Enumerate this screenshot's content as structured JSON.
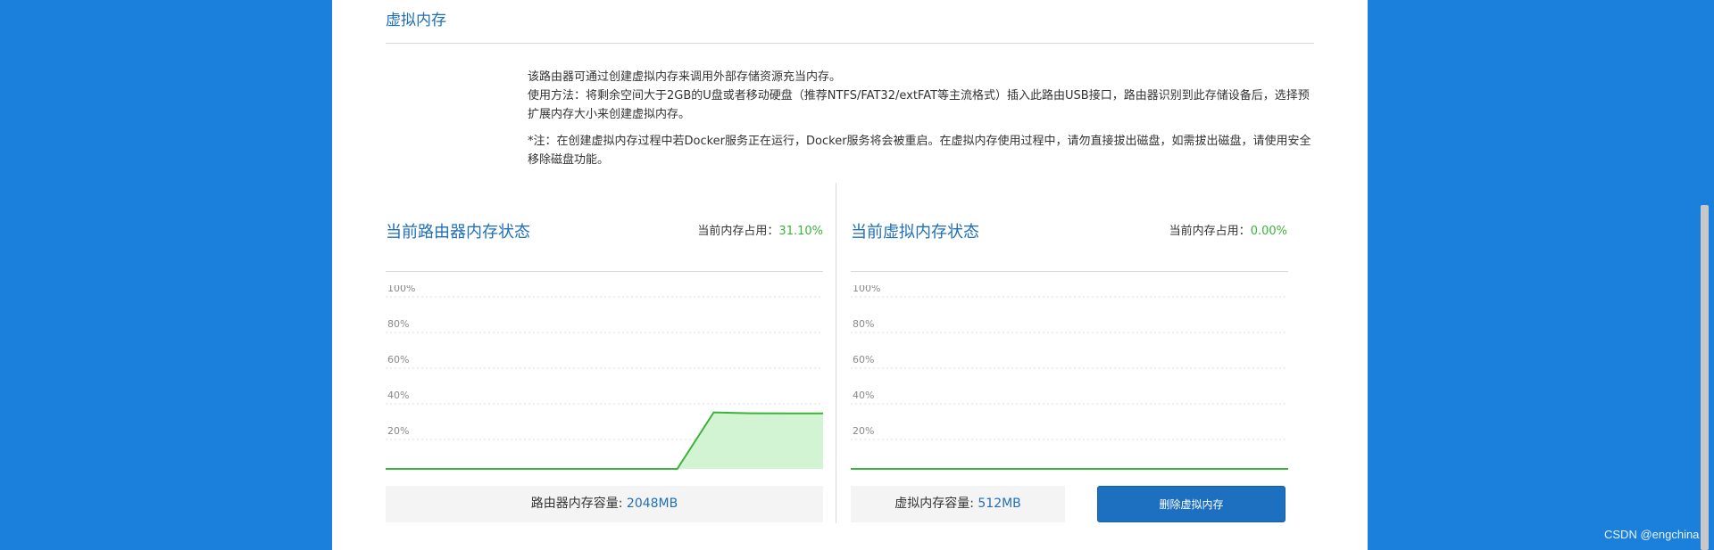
{
  "section": {
    "title": "虚拟内存",
    "desc_lines": [
      "该路由器可通过创建虚拟内存来调用外部存储资源充当内存。",
      "使用方法：将剩余空间大于2GB的U盘或者移动硬盘（推荐NTFS/FAT32/extFAT等主流格式）插入此路由USB接口，路由器识别到此存储设备后，选择预扩展内存大小来创建虚拟内存。"
    ],
    "note": "*注：在创建虚拟内存过程中若Docker服务正在运行，Docker服务将会被重启。在虚拟内存使用过程中，请勿直接拔出磁盘，如需拔出磁盘，请使用安全移除磁盘功能。"
  },
  "router_memory": {
    "title": "当前路由器内存状态",
    "usage_label": "当前内存占用：",
    "usage_value": "31.10%",
    "capacity_label": "路由器内存容量:",
    "capacity_value": "2048MB"
  },
  "virtual_memory": {
    "title": "当前虚拟内存状态",
    "usage_label": "当前内存占用：",
    "usage_value": "0.00%",
    "capacity_label": "虚拟内存容量:",
    "capacity_value": "512MB",
    "delete_button": "删除虚拟内存"
  },
  "colors": {
    "accent": "#1f6fb8",
    "green": "#3ab33a",
    "background": "#1b80dc"
  },
  "watermark": "CSDN @engchina",
  "chart_data": [
    {
      "type": "area",
      "y_ticks": [
        "100%",
        "80%",
        "60%",
        "40%",
        "20%"
      ],
      "ylim": [
        0,
        100
      ],
      "x": [
        0,
        1,
        2,
        3,
        4,
        5,
        6,
        7,
        8,
        9,
        10,
        11,
        12
      ],
      "values": [
        0,
        0,
        0,
        0,
        0,
        0,
        0,
        0,
        0,
        31.7,
        31.2,
        31.1,
        31.1
      ],
      "grid": true
    },
    {
      "type": "area",
      "y_ticks": [
        "100%",
        "80%",
        "60%",
        "40%",
        "20%"
      ],
      "ylim": [
        0,
        100
      ],
      "x": [
        0,
        1,
        2,
        3,
        4,
        5,
        6,
        7,
        8,
        9,
        10,
        11,
        12
      ],
      "values": [
        0,
        0,
        0,
        0,
        0,
        0,
        0,
        0,
        0,
        0,
        0,
        0,
        0
      ],
      "grid": true
    }
  ]
}
